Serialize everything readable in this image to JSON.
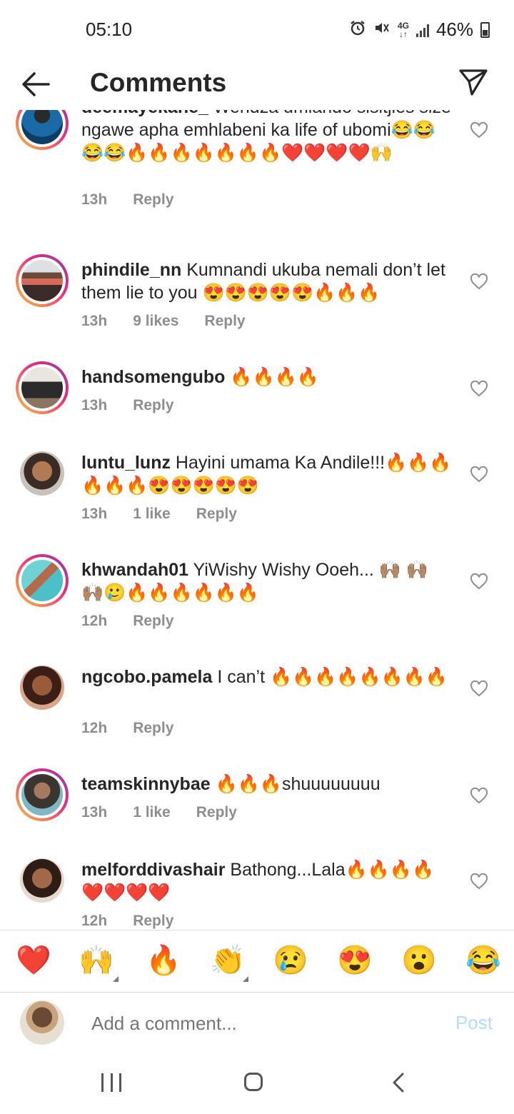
{
  "status_bar": {
    "time": "05:10",
    "network": "4G",
    "battery_percent": "46%",
    "icons": [
      "alarm-icon",
      "mute-icon",
      "network-4g-icon",
      "signal-icon",
      "battery-icon"
    ]
  },
  "header": {
    "title": "Comments",
    "back_icon": "arrow-left-icon",
    "share_icon": "paper-plane-icon"
  },
  "comments": [
    {
      "username": "deemayekane_",
      "text": " Wendza umlando sisitjies size ngawe apha emhlabeni ka life of ubomi😂😂😂😂🔥🔥🔥🔥🔥🔥🔥❤️❤️❤️❤️🙌",
      "time": "13h",
      "likes": "",
      "reply": "Reply",
      "story_ring": true
    },
    {
      "username": "phindile_nn",
      "text": " Kumnandi ukuba nemali don’t let them lie to you 😍😍😍😍😍🔥🔥🔥",
      "time": "13h",
      "likes": "9 likes",
      "reply": "Reply",
      "story_ring": true
    },
    {
      "username": "handsomengubo",
      "text": " 🔥🔥🔥🔥",
      "time": "13h",
      "likes": "",
      "reply": "Reply",
      "story_ring": true
    },
    {
      "username": "luntu_lunz",
      "text": " Hayini umama Ka Andile!!!🔥🔥🔥🔥🔥🔥😍😍😍😍😍",
      "time": "13h",
      "likes": "1 like",
      "reply": "Reply",
      "story_ring": false
    },
    {
      "username": "khwandah01",
      "text": " YiWishy Wishy Ooeh... 🙌🏽 🙌🏽 🙌🏽🥲🔥🔥🔥🔥🔥🔥",
      "time": "12h",
      "likes": "",
      "reply": "Reply",
      "story_ring": true
    },
    {
      "username": "ngcobo.pamela",
      "text": " I can’t 🔥🔥🔥🔥🔥🔥🔥🔥",
      "time": "12h",
      "likes": "",
      "reply": "Reply",
      "story_ring": false
    },
    {
      "username": "teamskinnybae",
      "text": " 🔥🔥🔥shuuuuuuuu",
      "time": "13h",
      "likes": "1 like",
      "reply": "Reply",
      "story_ring": true
    },
    {
      "username": "melforddivashair",
      "text": " Bathong...Lala🔥🔥🔥🔥❤️❤️❤️❤️",
      "time": "12h",
      "likes": "",
      "reply": "Reply",
      "story_ring": false
    }
  ],
  "reactions": [
    "❤️",
    "🙌",
    "🔥",
    "👏",
    "😢",
    "😍",
    "😮",
    "😂"
  ],
  "composer": {
    "placeholder": "Add a comment...",
    "post_label": "Post"
  },
  "nav": {
    "icons": [
      "recent-apps-icon",
      "home-icon",
      "back-icon"
    ]
  }
}
